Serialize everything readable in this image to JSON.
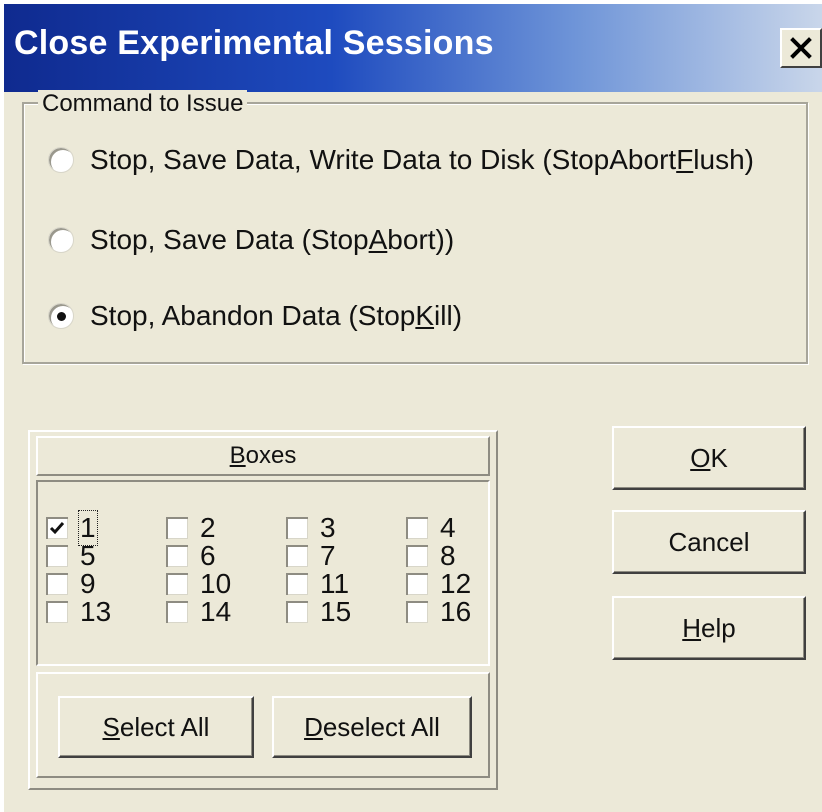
{
  "window": {
    "title": "Close Experimental Sessions",
    "close_icon": "close-icon"
  },
  "command_group": {
    "legend": "Command to Issue",
    "options": [
      {
        "id": "stop-abort-flush",
        "label_before": "Stop, Save Data, Write Data to Disk (StopAbort",
        "label_mnemonic": "F",
        "label_after": "lush)",
        "selected": false
      },
      {
        "id": "stop-abort",
        "label_before": "Stop, Save Data (Stop",
        "label_mnemonic": "A",
        "label_after": "bort))",
        "selected": false
      },
      {
        "id": "stop-kill",
        "label_before": "Stop, Abandon Data (Stop",
        "label_mnemonic": "K",
        "label_after": "ill)",
        "selected": true
      }
    ]
  },
  "boxes": {
    "header_mnemonic": "B",
    "header_rest": "oxes",
    "items": [
      {
        "label": "1",
        "checked": true,
        "focused": true
      },
      {
        "label": "2",
        "checked": false
      },
      {
        "label": "3",
        "checked": false
      },
      {
        "label": "4",
        "checked": false
      },
      {
        "label": "5",
        "checked": false
      },
      {
        "label": "6",
        "checked": false
      },
      {
        "label": "7",
        "checked": false
      },
      {
        "label": "8",
        "checked": false
      },
      {
        "label": "9",
        "checked": false
      },
      {
        "label": "10",
        "checked": false
      },
      {
        "label": "11",
        "checked": false
      },
      {
        "label": "12",
        "checked": false
      },
      {
        "label": "13",
        "checked": false
      },
      {
        "label": "14",
        "checked": false
      },
      {
        "label": "15",
        "checked": false
      },
      {
        "label": "16",
        "checked": false
      }
    ],
    "select_all": {
      "mnemonic": "S",
      "rest": "elect All"
    },
    "deselect_all": {
      "mnemonic": "D",
      "rest": "eselect All"
    }
  },
  "buttons": {
    "ok": {
      "mnemonic": "O",
      "rest": "K"
    },
    "cancel": {
      "label": "Cancel"
    },
    "help": {
      "mnemonic": "H",
      "rest": "elp"
    }
  },
  "colors": {
    "dialog_face": "#ece9d8",
    "titlebar_start": "#0f2a8f",
    "titlebar_end": "#c9d6ea",
    "title_text": "#ffffff"
  }
}
